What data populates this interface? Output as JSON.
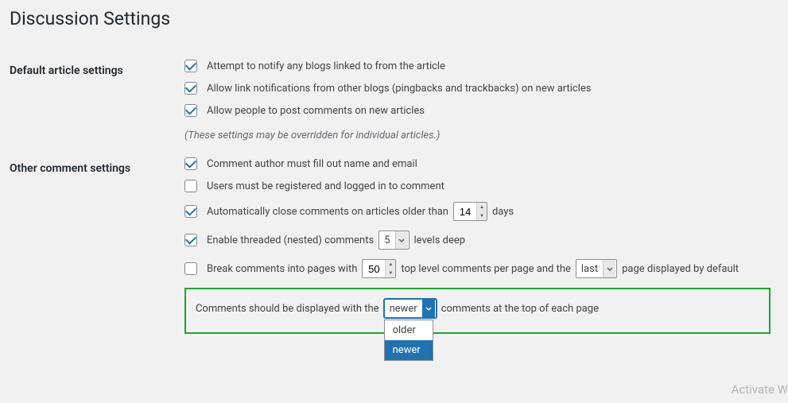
{
  "page_title": "Discussion Settings",
  "sections": {
    "default_article": {
      "heading": "Default article settings",
      "notify_blogs": {
        "checked": true,
        "label": "Attempt to notify any blogs linked to from the article"
      },
      "allow_pingbacks": {
        "checked": true,
        "label": "Allow link notifications from other blogs (pingbacks and trackbacks) on new articles"
      },
      "allow_comments": {
        "checked": true,
        "label": "Allow people to post comments on new articles"
      },
      "override_note": "(These settings may be overridden for individual articles.)"
    },
    "other_comment": {
      "heading": "Other comment settings",
      "require_name_email": {
        "checked": true,
        "label": "Comment author must fill out name and email"
      },
      "require_registration": {
        "checked": false,
        "label": "Users must be registered and logged in to comment"
      },
      "auto_close": {
        "checked": true,
        "label_before": "Automatically close comments on articles older than",
        "days_value": "14",
        "label_after": "days"
      },
      "threaded": {
        "checked": true,
        "label_before": "Enable threaded (nested) comments",
        "levels_value": "5",
        "label_after": "levels deep"
      },
      "paginate": {
        "checked": false,
        "label_before": "Break comments into pages with",
        "per_page_value": "50",
        "label_mid": "top level comments per page and the",
        "page_order_value": "last",
        "label_after": "page displayed by default"
      },
      "display_order": {
        "label_before": "Comments should be displayed with the",
        "selected": "newer",
        "options": [
          "older",
          "newer"
        ],
        "label_after": "comments at the top of each page"
      }
    }
  },
  "watermark": "Activate W"
}
